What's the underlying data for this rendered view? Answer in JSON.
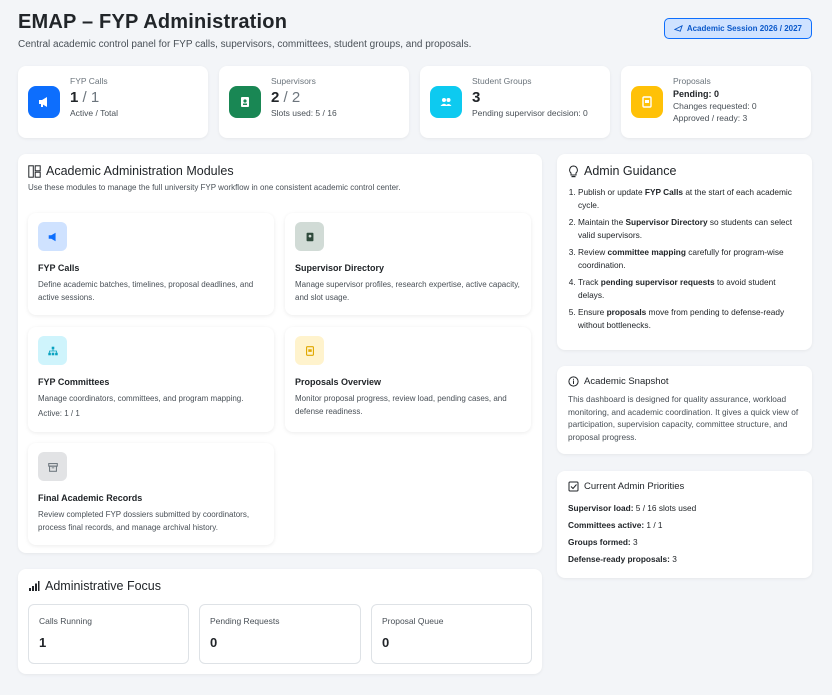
{
  "header": {
    "title": "EMAP – FYP Administration",
    "subtitle": "Central academic control panel for FYP calls, supervisors, committees, student groups, and proposals.",
    "session_label": "Academic Session 2026 / 2027"
  },
  "stats": {
    "calls": {
      "label": "FYP Calls",
      "value": "1",
      "total": "/ 1",
      "sub": "Active / Total",
      "color": "#0d6efd"
    },
    "supervisors": {
      "label": "Supervisors",
      "value": "2",
      "total": "/ 2",
      "sub": "Slots used: 5 / 16",
      "color": "#198754"
    },
    "groups": {
      "label": "Student Groups",
      "value": "3",
      "sub": "Pending supervisor decision: 0",
      "color": "#0dcaf0"
    },
    "proposals": {
      "label": "Proposals",
      "pending": "Pending: 0",
      "changes": "Changes requested: 0",
      "approved": "Approved / ready: 3",
      "color": "#ffc107"
    }
  },
  "modules": {
    "title": "Academic Administration Modules",
    "subtitle": "Use these modules to manage the full university FYP workflow in one consistent academic control center.",
    "items": [
      {
        "title": "FYP Calls",
        "desc": "Define academic batches, timelines, proposal deadlines, and active sessions."
      },
      {
        "title": "Supervisor Directory",
        "desc": "Manage supervisor profiles, research expertise, active capacity, and slot usage."
      },
      {
        "title": "FYP Committees",
        "desc": "Manage coordinators, committees, and program mapping.",
        "extra": "Active: 1 / 1"
      },
      {
        "title": "Proposals Overview",
        "desc": "Monitor proposal progress, review load, pending cases, and defense readiness."
      },
      {
        "title": "Final Academic Records",
        "desc": "Review completed FYP dossiers submitted by coordinators, process final records, and manage archival history."
      }
    ]
  },
  "focus": {
    "title": "Administrative Focus",
    "items": [
      {
        "label": "Calls Running",
        "value": "1"
      },
      {
        "label": "Pending Requests",
        "value": "0"
      },
      {
        "label": "Proposal Queue",
        "value": "0"
      }
    ]
  },
  "guidance": {
    "title": "Admin Guidance",
    "steps": [
      {
        "pre": "Publish or update ",
        "bold": "FYP Calls",
        "post": " at the start of each academic cycle."
      },
      {
        "pre": "Maintain the ",
        "bold": "Supervisor Directory",
        "post": " so students can select valid supervisors."
      },
      {
        "pre": "Review ",
        "bold": "committee mapping",
        "post": " carefully for program-wise coordination."
      },
      {
        "pre": "Track ",
        "bold": "pending supervisor requests",
        "post": " to avoid student delays."
      },
      {
        "pre": "Ensure ",
        "bold": "proposals",
        "post": " move from pending to defense-ready without bottlenecks."
      }
    ]
  },
  "snapshot": {
    "title": "Academic Snapshot",
    "text": "This dashboard is designed for quality assurance, workload monitoring, and academic coordination. It gives a quick view of participation, supervision capacity, committee structure, and proposal progress."
  },
  "priorities": {
    "title": "Current Admin Priorities",
    "rows": [
      {
        "label": "Supervisor load:",
        "value": " 5 / 16 slots used"
      },
      {
        "label": "Committees active:",
        "value": " 1 / 1"
      },
      {
        "label": "Groups formed:",
        "value": " 3"
      },
      {
        "label": "Defense-ready proposals:",
        "value": " 3"
      }
    ]
  }
}
